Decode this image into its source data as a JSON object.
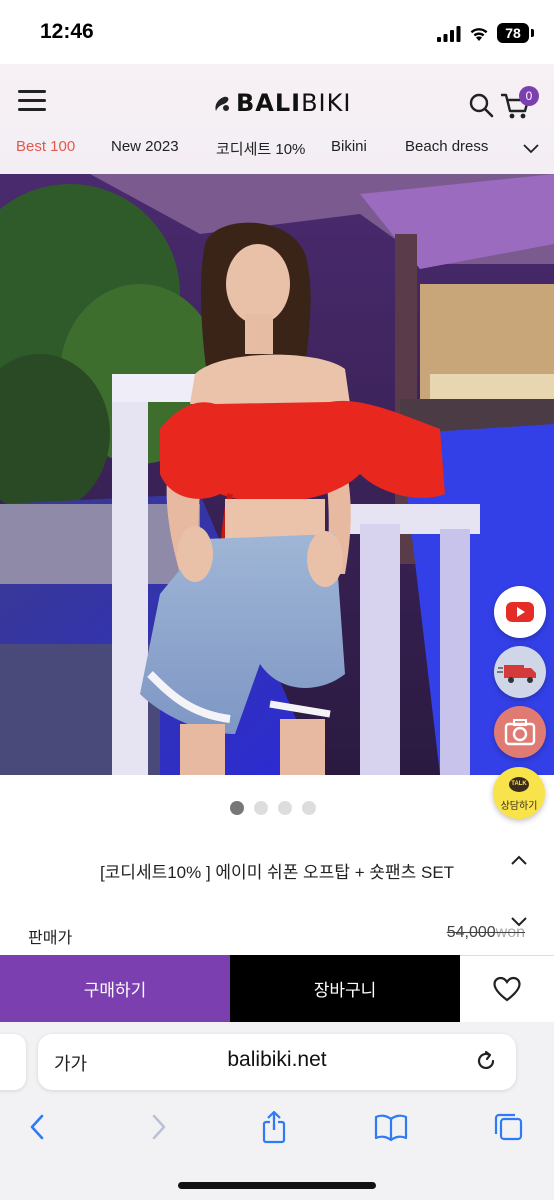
{
  "status": {
    "time": "12:46",
    "battery": "78"
  },
  "header": {
    "logo_strong": "BALI",
    "logo_light": "BIKI",
    "cart_count": "0"
  },
  "categories": [
    {
      "label": "Best 100",
      "active": true
    },
    {
      "label": "New 2023",
      "active": false
    },
    {
      "label": "코디세트 10%",
      "active": false
    },
    {
      "label": "Bikini",
      "active": false
    },
    {
      "label": "Beach dress",
      "active": false
    }
  ],
  "floating": {
    "talk_label": "상담하기",
    "talk_bubble": "TALK"
  },
  "carousel": {
    "total": 4,
    "active_index": 0
  },
  "product": {
    "title": "[코디세트10% ] 에이미 쉬폰 오프탑 + 숏팬츠 SET",
    "price_label": "판매가",
    "price_amount": "54,000",
    "price_unit": "won"
  },
  "actions": {
    "buy_label": "구매하기",
    "cart_label": "장바구니"
  },
  "browser": {
    "text_size": "가가",
    "url": "balibiki.net"
  },
  "colors": {
    "brand_purple": "#7b3fb0",
    "accent_red": "#e05a4c",
    "shirt_red": "#e8271e"
  }
}
